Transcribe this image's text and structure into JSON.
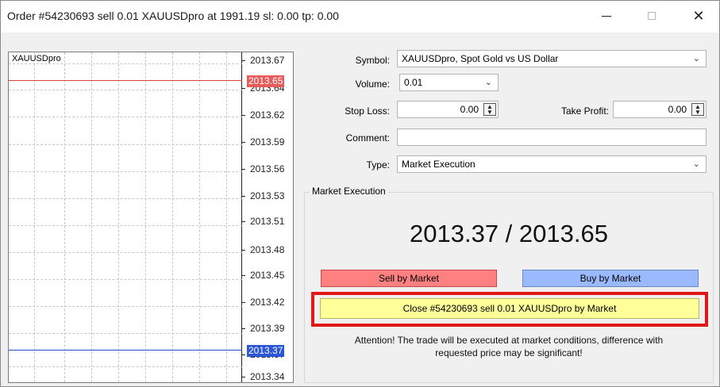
{
  "window": {
    "title": "Order #54230693 sell 0.01 XAUUSDpro at 1991.19 sl: 0.00 tp: 0.00",
    "minimize_glyph": "—",
    "close_glyph": "✕"
  },
  "chart": {
    "symbol": "XAUUSDpro",
    "ask_price": "2013.65",
    "bid_price": "2013.37",
    "ask_line_color": "#e04040",
    "bid_line_color": "#2050d0",
    "ticks": [
      "2013.67",
      "2013.64",
      "2013.62",
      "2013.59",
      "2013.56",
      "2013.53",
      "2013.51",
      "2013.48",
      "2013.45",
      "2013.42",
      "2013.39",
      "2013.37",
      "2013.34"
    ]
  },
  "form": {
    "symbol_label": "Symbol:",
    "symbol_value": "XAUUSDpro, Spot Gold vs US Dollar",
    "volume_label": "Volume:",
    "volume_value": "0.01",
    "stop_loss_label": "Stop Loss:",
    "stop_loss_value": "0.00",
    "take_profit_label": "Take Profit:",
    "take_profit_value": "0.00",
    "comment_label": "Comment:",
    "comment_value": "",
    "type_label": "Type:",
    "type_value": "Market Execution"
  },
  "execution": {
    "group_title": "Market Execution",
    "prices": "2013.37 / 2013.65",
    "sell_label": "Sell by Market",
    "buy_label": "Buy by Market",
    "close_label": "Close #54230693 sell 0.01 XAUUSDpro by Market",
    "attention_line1": "Attention! The trade will be executed at market conditions, difference with",
    "attention_line2": "requested price may be significant!",
    "sell_color": "#ff8080",
    "buy_color": "#9bb9ff",
    "close_color": "#ffff9a",
    "highlight_color": "#e01818"
  }
}
